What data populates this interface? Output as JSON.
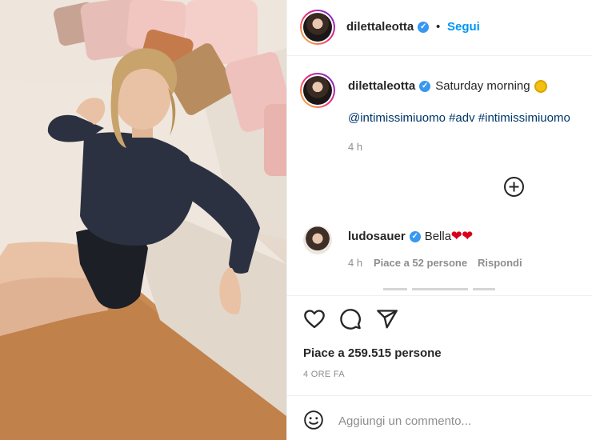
{
  "post": {
    "author": "dilettaleotta",
    "dot": "•",
    "follow_label": "Segui",
    "verified_glyph": "✓",
    "caption": "Saturday morning",
    "caption_emoji": "sun-emoji",
    "tags": "@intimissimiuomo #adv #intimissimiuomo",
    "time_ago": "4 h",
    "likes": "Piace a 259.515 persone",
    "timestamp": "4 ORE FA"
  },
  "comment": {
    "user": "ludosauer",
    "text": "Bella",
    "emoji": "❤❤",
    "time_ago": "4 h",
    "likes": "Piace a 52 persone",
    "reply_label": "Rispondi"
  },
  "composer": {
    "placeholder": "Aggiungi un commento..."
  },
  "icons": {
    "like": "heart-icon",
    "comment": "comment-icon",
    "share": "share-icon",
    "emoji": "emoji-icon",
    "more_replies": "plus-circle-icon"
  },
  "colors": {
    "link": "#0095f6",
    "hashtag": "#00376b",
    "verified": "#3897f0",
    "muted": "#8e8e8e"
  }
}
